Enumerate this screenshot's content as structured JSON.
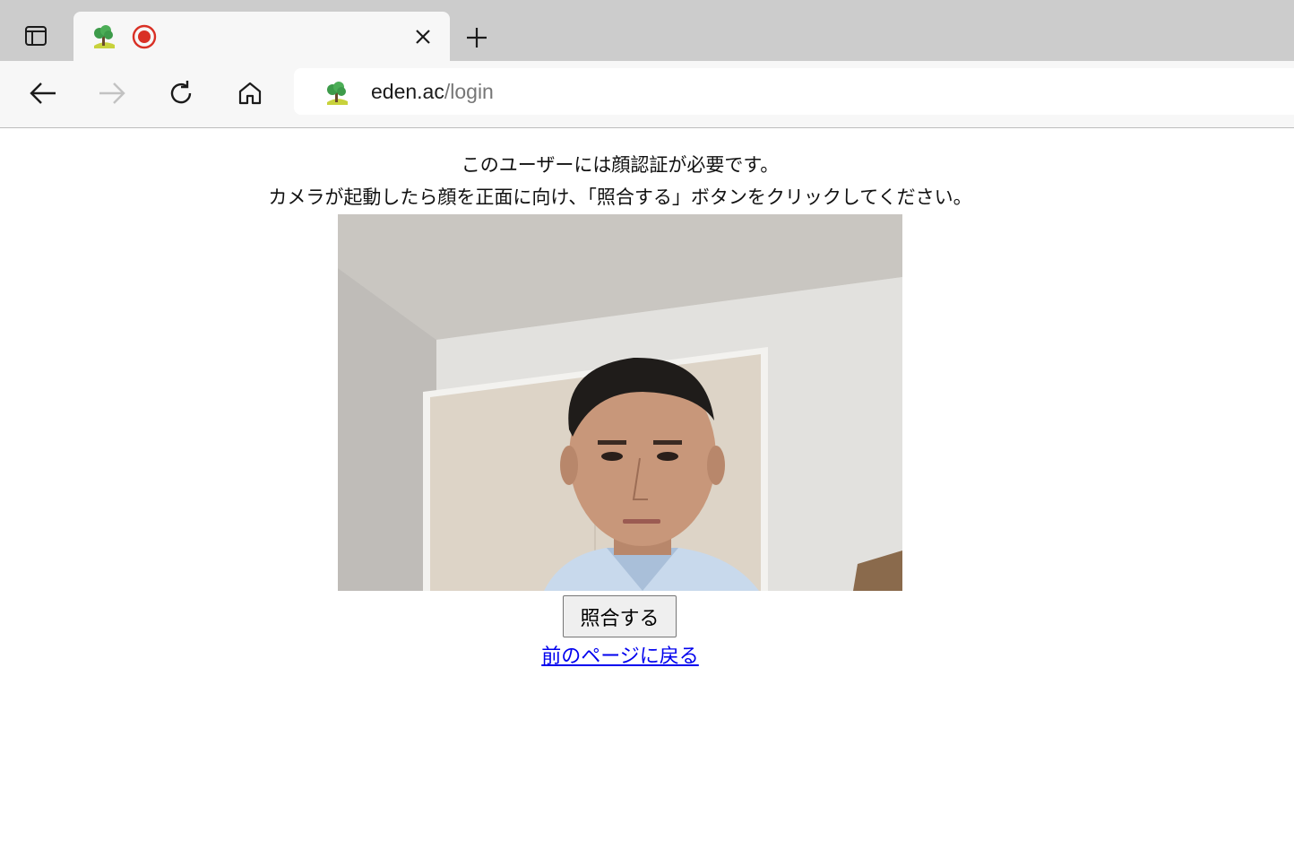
{
  "browser": {
    "tab": {
      "favicon": "tree-icon",
      "recording_indicator": "record-icon",
      "close_icon": "close-icon"
    },
    "new_tab_icon": "plus-icon",
    "toolbar": {
      "back_icon": "arrow-left-icon",
      "forward_icon": "arrow-right-icon",
      "reload_icon": "reload-icon",
      "home_icon": "home-icon"
    },
    "address_bar": {
      "site_icon": "tree-icon",
      "host": "eden.ac",
      "path": "/login"
    }
  },
  "page": {
    "message_line1": "このユーザーには顔認証が必要です。",
    "message_line2": "カメラが起動したら顔を正面に向け、「照合する」ボタンをクリックしてください。",
    "camera_feed": "camera-preview",
    "verify_button": "照合する",
    "back_link": "前のページに戻る"
  },
  "colors": {
    "tabstrip": "#cccccc",
    "toolbar": "#f7f7f7",
    "record": "#d93025",
    "link": "#0000ee"
  }
}
